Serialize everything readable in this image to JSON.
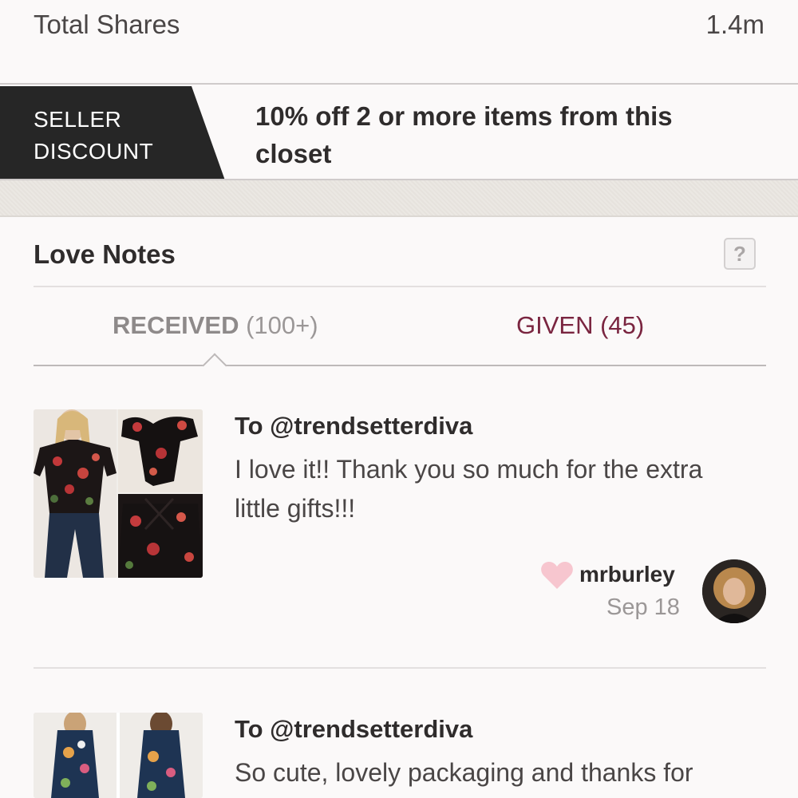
{
  "stats": {
    "total_shares_label": "Total Shares",
    "total_shares_value": "1.4m"
  },
  "discount": {
    "tag_line1": "SELLER",
    "tag_line2": "DISCOUNT",
    "text": "10% off 2 or more items from this closet"
  },
  "love_notes": {
    "title": "Love Notes",
    "help_label": "?",
    "tabs": {
      "received_label": "RECEIVED",
      "received_count": "(100+)",
      "given_label": "GIVEN (45)"
    },
    "notes": [
      {
        "to": "To @trendsetterdiva",
        "message": "I love it!! Thank you so much for the extra little gifts!!!",
        "sender": "mrburley",
        "date": "Sep 18"
      },
      {
        "to": "To @trendsetterdiva",
        "message": "So cute, lovely packaging and thanks for"
      }
    ]
  },
  "colors": {
    "given_accent": "#7a2540",
    "heart": "#f7c6cf",
    "tag_bg": "#262626"
  },
  "icons": {
    "help": "question-icon",
    "heart": "heart-icon"
  }
}
